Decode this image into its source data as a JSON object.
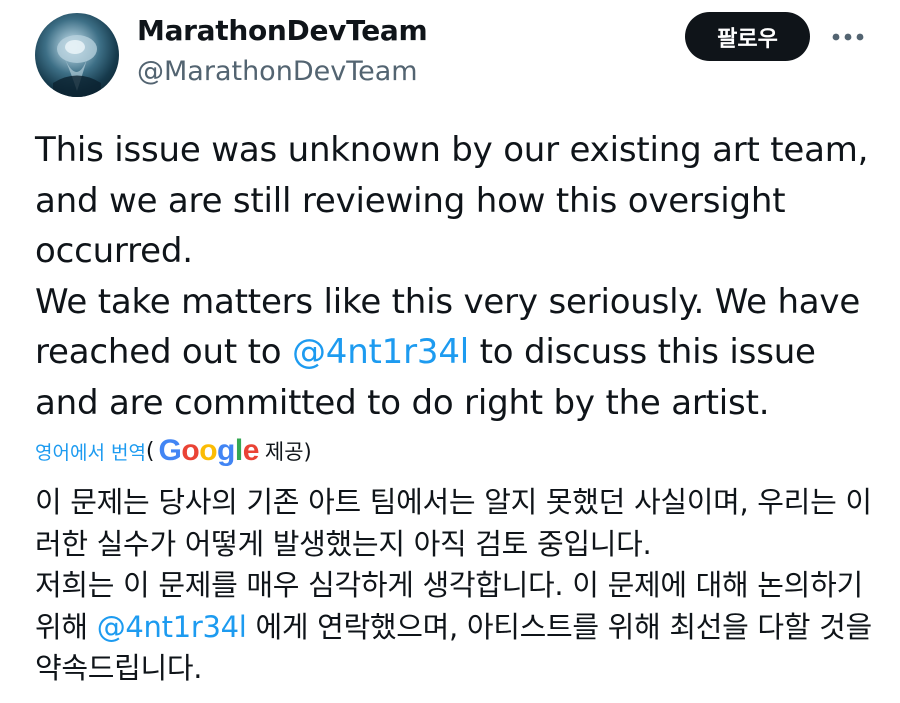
{
  "author": {
    "display_name": "MarathonDevTeam",
    "handle": "@MarathonDevTeam"
  },
  "header": {
    "follow_label": "팔로우",
    "more_icon": "more-horizontal-icon"
  },
  "tweet": {
    "paragraph1": "This issue was unknown by our existing art team, and we are still reviewing how this oversight occurred.",
    "p2_before": "We take matters like this very seriously. We have reached out to ",
    "p2_mention": "@4nt1r34l",
    "p2_after": " to discuss this issue and are committed to do right by the artist."
  },
  "translation": {
    "translate_link": "영어에서 번역",
    "open_paren": "(",
    "google_logo": "Google",
    "provided_by": "제공)",
    "paragraph1": "이 문제는 당사의 기존 아트 팀에서는 알지 못했던 사실이며, 우리는 이러한 실수가 어떻게 발생했는지 아직 검토 중입니다.",
    "p2_before": "저희는 이 문제를 매우 심각하게 생각합니다. 이 문제에 대해 논의하기 위해 ",
    "p2_mention": "@4nt1r34l",
    "p2_after": " 에게 연락했으며, 아티스트를 위해 최선을 다할 것을 약속드립니다."
  },
  "colors": {
    "text": "#0f1419",
    "secondary": "#536471",
    "link": "#1d9bf0",
    "button_bg": "#0f1419"
  }
}
